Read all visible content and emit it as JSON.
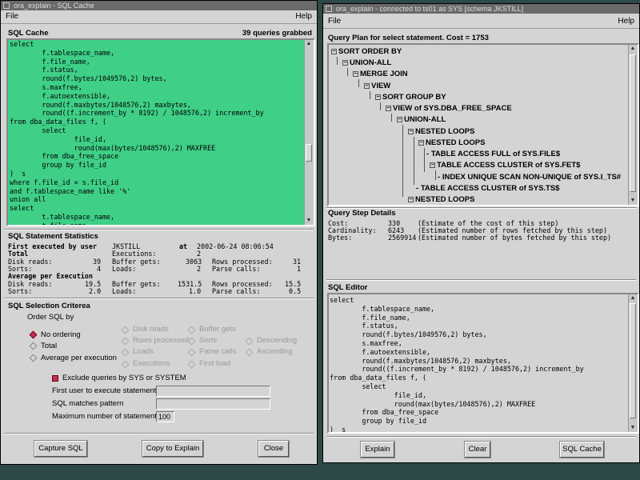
{
  "left_window": {
    "title": "ora_explain - SQL Cache",
    "menu": {
      "file": "File",
      "help": "Help"
    },
    "cache": {
      "title": "SQL Cache",
      "count": "39 queries grabbed",
      "sql_text": "select\n        f.tablespace_name,\n        f.file_name,\n        f.status,\n        round(f.bytes/1049576,2) bytes,\n        s.maxfree,\n        f.autoextensible,\n        round(f.maxbytes/1048576,2) maxbytes,\n        round((f.increment_by * 8192) / 1048576,2) increment_by\nfrom dba_data_files f, (\n        select\n                file_id,\n                round(max(bytes/1048576),2) MAXFREE\n        from dba_free_space\n        group by file_id\n)  s\nwhere f.file_id = s.file_id\nand f.tablespace_name like '%'\nunion all\nselect\n        t.tablespace_name,\n        t.file_name,\n        t.status,\n        round(t.bytes/1049576,2) bytes,\n        s.maxfree,",
      "bg_color": "#3fcf86"
    },
    "stats": {
      "title": "SQL Statement Statistics",
      "first_label": "First executed by user",
      "first_user": "JKSTILL",
      "at_label": "at",
      "at_value": "2002-06-24 08:06:54",
      "total_label": "Total",
      "executions_label": "Executions:",
      "executions_value": "2",
      "disk_reads_label": "Disk reads:",
      "disk_reads_total": "39",
      "buffer_gets_label": "Buffer gets:",
      "buffer_gets_total": "3063",
      "rows_processed_label": "Rows processed:",
      "rows_processed_total": "31",
      "sorts_label": "Sorts:",
      "sorts_total": "4",
      "loads_label": "Loads:",
      "loads_total": "2",
      "parse_calls_label": "Parse calls:",
      "parse_calls_total": "1",
      "avg_label": "Average per Execution",
      "disk_reads_avg": "19.5",
      "buffer_gets_avg": "1531.5",
      "rows_processed_avg": "15.5",
      "sorts_avg": "2.0",
      "loads_avg": "1.0",
      "parse_calls_avg": "0.5"
    },
    "criteria": {
      "title": "SQL Selection Criterea",
      "order_label": "Order SQL by",
      "order_options": [
        "No ordering",
        "Total",
        "Average per execution"
      ],
      "selected": "No ordering",
      "sort_fields": [
        "Disk reads",
        "Buffer gets",
        "Rows processed",
        "Sorts",
        "Descending",
        "Loads",
        "Parse calls",
        "Ascending",
        "Executions",
        "First load"
      ],
      "exclude_label": "Exclude queries by SYS or SYSTEM",
      "first_user_label": "First user to execute statement",
      "first_user_value": "",
      "pattern_label": "SQL matches pattern",
      "pattern_value": "",
      "max_label": "Maximum number of statements",
      "max_value": "100"
    },
    "buttons": {
      "capture": "Capture SQL",
      "copy": "Copy to Explain",
      "close": "Close"
    }
  },
  "right_window": {
    "title": "ora_explain - connected to ts01 as SYS [schema JKSTILL]",
    "menu": {
      "file": "File",
      "help": "Help"
    },
    "plan": {
      "title": "Query Plan for select statement.  Cost = 1753",
      "nodes": [
        "SORT ORDER BY",
        "UNION-ALL",
        "MERGE JOIN",
        "VIEW",
        "SORT GROUP BY",
        "VIEW of SYS.DBA_FREE_SPACE",
        "UNION-ALL",
        "NESTED LOOPS",
        "NESTED LOOPS",
        "TABLE ACCESS FULL of SYS.FILE$",
        "TABLE ACCESS CLUSTER of SYS.FET$",
        "INDEX UNIQUE SCAN NON-UNIQUE of SYS.I_TS#",
        "TABLE ACCESS CLUSTER of SYS.TS$",
        "NESTED LOOPS"
      ]
    },
    "details": {
      "title": "Query Step Details",
      "rows": [
        {
          "label": "Cost:",
          "value": "330",
          "desc": "(Estimate of the cost of this step)"
        },
        {
          "label": "Cardinality:",
          "value": "6243",
          "desc": "(Estimated number of rows fetched by this step)"
        },
        {
          "label": "Bytes:",
          "value": "2569914",
          "desc": "(Estimated number of bytes fetched by this step)"
        }
      ]
    },
    "editor": {
      "title": "SQL Editor",
      "sql_text": "select\n        f.tablespace_name,\n        f.file_name,\n        f.status,\n        round(f.bytes/1049576,2) bytes,\n        s.maxfree,\n        f.autoextensible,\n        round(f.maxbytes/1048576,2) maxbytes,\n        round((f.increment_by * 8192) / 1048576,2) increment_by\nfrom dba_data_files f, (\n        select\n                file_id,\n                round(max(bytes/1048576),2) MAXFREE\n        from dba_free_space\n        group by file_id\n)  s\nwhere f.file_id = s.file_id\nand f.tablespace_name like '%'\nunion all"
    },
    "buttons": {
      "explain": "Explain",
      "clear": "Clear",
      "cache": "SQL Cache"
    }
  }
}
